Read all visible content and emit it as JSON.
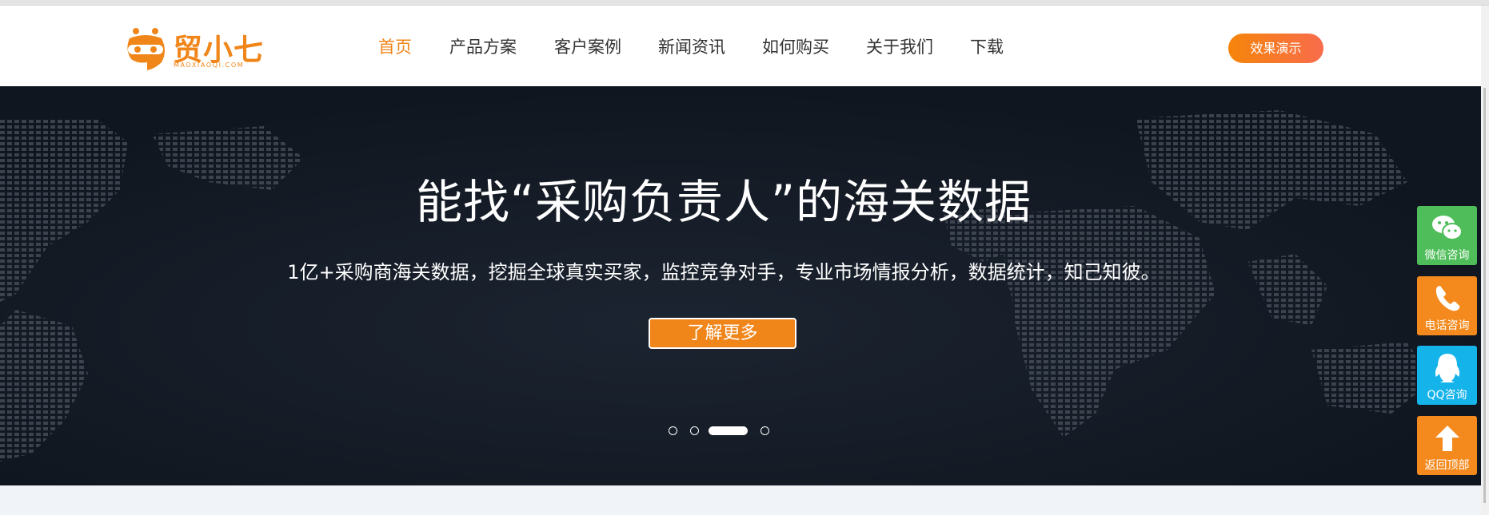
{
  "brand": {
    "name": "贸小七",
    "domain": "MAOXIAOQI.COM",
    "color": "#f08519"
  },
  "nav": {
    "items": [
      {
        "label": "首页",
        "active": true
      },
      {
        "label": "产品方案",
        "active": false
      },
      {
        "label": "客户案例",
        "active": false
      },
      {
        "label": "新闻资讯",
        "active": false
      },
      {
        "label": "如何购买",
        "active": false
      },
      {
        "label": "关于我们",
        "active": false
      },
      {
        "label": "下载",
        "active": false
      }
    ],
    "demo_button": "效果演示"
  },
  "hero": {
    "title": "能找“采购负责人”的海关数据",
    "subtitle": "1亿+采购商海关数据，挖掘全球真实买家，监控竞争对手，专业市场情报分析，数据统计，知己知彼。",
    "button": "了解更多",
    "slides": 4,
    "active_slide": 3
  },
  "float_tools": [
    {
      "label": "微信咨询",
      "icon": "wechat-icon",
      "color": "#4fbe5a"
    },
    {
      "label": "电话咨询",
      "icon": "phone-icon",
      "color": "#f48a1d"
    },
    {
      "label": "QQ咨询",
      "icon": "qq-icon",
      "color": "#14b3ea"
    },
    {
      "label": "返回顶部",
      "icon": "arrow-up-icon",
      "color": "#f48a1d"
    }
  ]
}
